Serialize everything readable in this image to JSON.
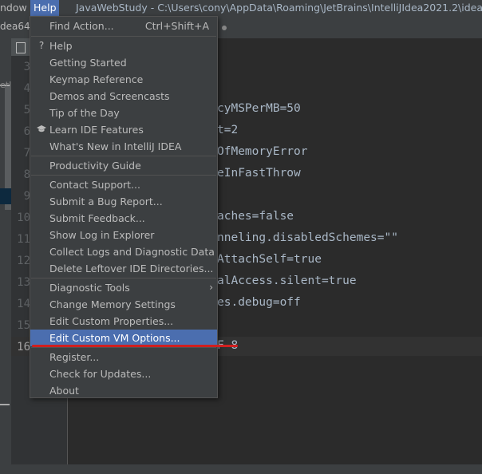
{
  "menubar": {
    "window_label": "ndow",
    "help_label": "Help",
    "title": "JavaWebStudy - C:\\Users\\cony\\AppData\\Roaming\\JetBrains\\IntelliJIdea2021.2\\idea64.e"
  },
  "tab_left_label": "dea64.ex",
  "left_panel_label": "etJD",
  "editor": {
    "line_numbers": [
      "3",
      "4",
      "5",
      "6",
      "7",
      "8",
      "9",
      "10",
      "11",
      "12",
      "13",
      "14",
      "15",
      "16"
    ],
    "code_lines": [
      "cyMSPerMB=50",
      "t=2",
      "OfMemoryError",
      "eInFastThrow",
      "aches=false",
      "nneling.disabledSchemes=\"\"",
      "AttachSelf=true",
      "alAccess.silent=true",
      "es.debug=off",
      "F-8"
    ]
  },
  "help_menu": {
    "find_action": "Find Action...",
    "find_action_shortcut": "Ctrl+Shift+A",
    "help": "Help",
    "help_icon": "question-icon",
    "getting_started": "Getting Started",
    "keymap_reference": "Keymap Reference",
    "demos": "Demos and Screencasts",
    "tip_of_day": "Tip of the Day",
    "learn_ide": "Learn IDE Features",
    "learn_icon": "graduation-cap-icon",
    "whats_new": "What's New in IntelliJ IDEA",
    "productivity_guide": "Productivity Guide",
    "contact_support": "Contact Support...",
    "submit_bug": "Submit a Bug Report...",
    "submit_feedback": "Submit Feedback...",
    "show_log": "Show Log in Explorer",
    "collect_logs": "Collect Logs and Diagnostic Data",
    "delete_leftover": "Delete Leftover IDE Directories...",
    "diagnostic_tools": "Diagnostic Tools",
    "change_memory": "Change Memory Settings",
    "edit_custom_props": "Edit Custom Properties...",
    "edit_custom_vm": "Edit Custom VM Options...",
    "register": "Register...",
    "check_updates": "Check for Updates...",
    "about": "About"
  },
  "colors": {
    "selection": "#4b6eaf",
    "highlight_underline": "#d11f1f"
  }
}
